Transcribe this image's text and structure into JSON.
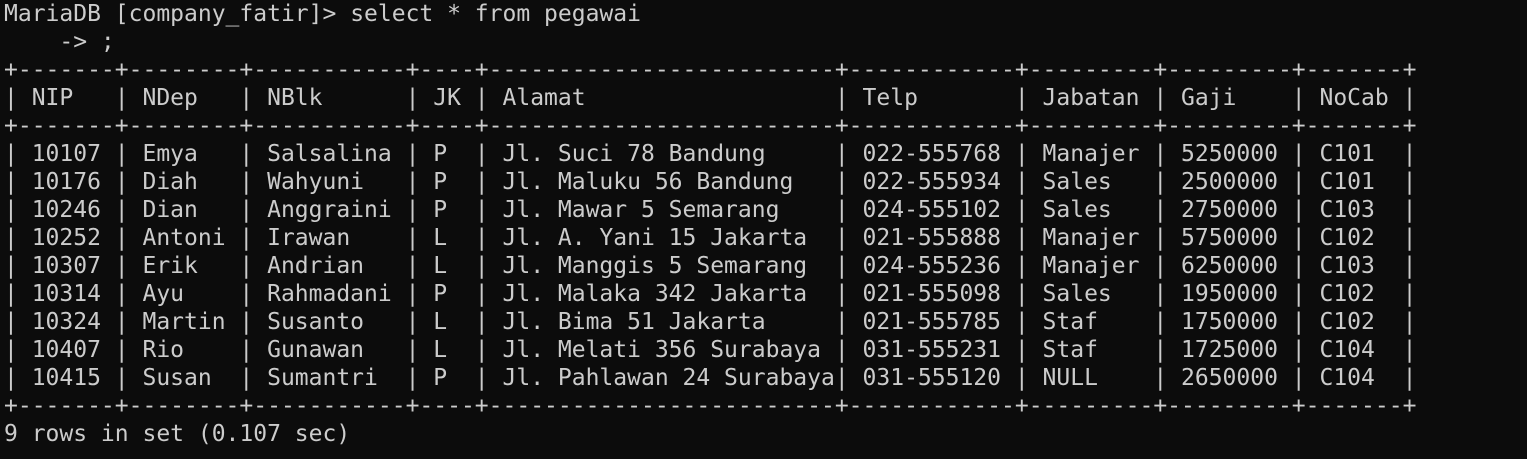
{
  "terminal": {
    "prompt": "MariaDB [company_fatir]> ",
    "command": "select * from pegawai",
    "continuation": "    -> ;",
    "lines": [
      "+-------+--------+-----------+----+-------------------------+------------+---------+---------+-------+",
      "| NIP   | NDep   | NBlk      | JK | Alamat                  | Telp       | Jabatan | Gaji    | NoCab |",
      "+-------+--------+-----------+----+-------------------------+------------+---------+---------+-------+",
      "| 10107 | Emya   | Salsalina | P  | Jl. Suci 78 Bandung     | 022-555768 | Manajer | 5250000 | C101  |",
      "| 10176 | Diah   | Wahyuni   | P  | Jl. Maluku 56 Bandung   | 022-555934 | Sales   | 2500000 | C101  |",
      "| 10246 | Dian   | Anggraini | P  | Jl. Mawar 5 Semarang    | 024-555102 | Sales   | 2750000 | C103  |",
      "| 10252 | Antoni | Irawan    | L  | Jl. A. Yani 15 Jakarta  | 021-555888 | Manajer | 5750000 | C102  |",
      "| 10307 | Erik   | Andrian   | L  | Jl. Manggis 5 Semarang  | 024-555236 | Manajer | 6250000 | C103  |",
      "| 10314 | Ayu    | Rahmadani | P  | Jl. Malaka 342 Jakarta  | 021-555098 | Sales   | 1950000 | C102  |",
      "| 10324 | Martin | Susanto   | L  | Jl. Bima 51 Jakarta     | 021-555785 | Staf    | 1750000 | C102  |",
      "| 10407 | Rio    | Gunawan   | L  | Jl. Melati 356 Surabaya | 031-555231 | Staf    | 1725000 | C104  |",
      "| 10415 | Susan  | Sumantri  | P  | Jl. Pahlawan 24 Surabaya| 031-555120 | NULL    | 2650000 | C104  |",
      "+-------+--------+-----------+----+-------------------------+------------+---------+---------+-------+"
    ],
    "footer": "9 rows in set (0.107 sec)"
  }
}
